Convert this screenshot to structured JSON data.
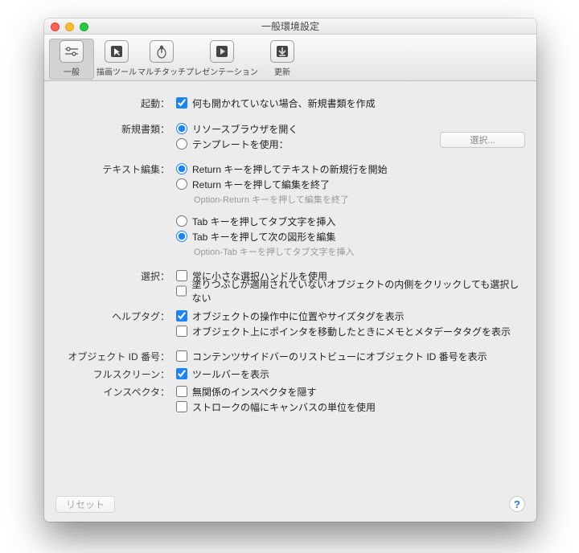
{
  "window": {
    "title": "一般環境設定"
  },
  "toolbar": {
    "general": "一般",
    "drawing": "描画ツール",
    "multitouch": "マルチタッチ",
    "presentation": "プレゼンテーション",
    "update": "更新"
  },
  "sections": {
    "startup": {
      "label": "起動：",
      "createNew": "何も開かれていない場合、新規書類を作成"
    },
    "newdoc": {
      "label": "新規書類：",
      "browser": "リソースブラウザを開く",
      "template": "テンプレートを使用：",
      "selectBtn": "選択..."
    },
    "textedit": {
      "label": "テキスト編集：",
      "returnNewline": "Return キーを押してテキストの新規行を開始",
      "returnEnd": "Return キーを押して編集を終了",
      "returnHint": "Option-Return キーを押して編集を終了",
      "tabChar": "Tab キーを押してタブ文字を挿入",
      "tabNext": "Tab キーを押して次の図形を編集",
      "tabHint": "Option-Tab キーを押してタブ文字を挿入"
    },
    "selection": {
      "label": "選択：",
      "smallHandles": "常に小さな選択ハンドルを使用",
      "noFillClick": "塗りつぶしが適用されていないオブジェクトの内側をクリックしても選択しない"
    },
    "helptag": {
      "label": "ヘルプタグ：",
      "showPosSize": "オブジェクトの操作中に位置やサイズタグを表示",
      "showNoteMeta": "オブジェクト上にポインタを移動したときにメモとメタデータタグを表示"
    },
    "objectid": {
      "label": "オブジェクト ID 番号：",
      "showId": "コンテンツサイドバーのリストビューにオブジェクト ID 番号を表示"
    },
    "fullscreen": {
      "label": "フルスクリーン：",
      "showToolbar": "ツールバーを表示"
    },
    "inspector": {
      "label": "インスペクタ：",
      "hideUnrelated": "無関係のインスペクタを隠す",
      "canvasUnits": "ストロークの幅にキャンバスの単位を使用"
    }
  },
  "footer": {
    "reset": "リセット"
  }
}
